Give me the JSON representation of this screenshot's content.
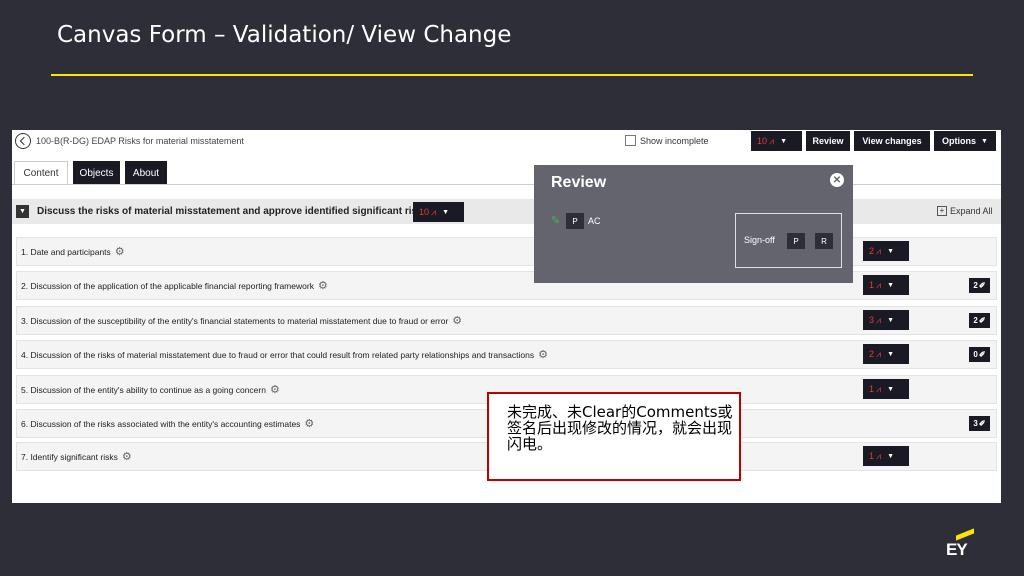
{
  "slide": {
    "title": "Canvas Form – Validation/ View Change",
    "logo": "EY"
  },
  "app": {
    "doc_title": "100-B(R-DG) EDAP Risks for material misstatement",
    "show_incomplete_label": "Show incomplete",
    "top_counter": "10",
    "review_button": "Review",
    "view_changes_button": "View changes",
    "options_button": "Options",
    "tabs": [
      {
        "label": "Content"
      },
      {
        "label": "Objects"
      },
      {
        "label": "About"
      }
    ],
    "section": {
      "title": "Discuss the risks of material misstatement and approve identified significant risks",
      "counter": "10",
      "expand_all": "Expand All"
    },
    "items": [
      {
        "label": "1. Date and participants",
        "counter": "2",
        "comments": ""
      },
      {
        "label": "2. Discussion of the application of the applicable financial reporting framework",
        "counter": "1",
        "comments": "2"
      },
      {
        "label": "3. Discussion of the susceptibility of the entity's financial statements to material misstatement due to fraud or error",
        "counter": "3",
        "comments": "2"
      },
      {
        "label": "4. Discussion of the risks of material misstatement due to fraud or error that could result from related party relationships and transactions",
        "counter": "2",
        "comments": "0"
      },
      {
        "label": "5. Discussion of the entity's ability to continue as a going concern",
        "counter": "1",
        "comments": ""
      },
      {
        "label": "6. Discussion of the risks associated with the entity's accounting estimates",
        "counter": "",
        "comments": "3"
      },
      {
        "label": "7. Identify significant risks",
        "counter": "1",
        "comments": ""
      }
    ]
  },
  "review_panel": {
    "title": "Review",
    "preparer_button": "P",
    "preparer_initials": "AC",
    "signoff_label": "Sign-off",
    "signoff_p": "P",
    "signoff_r": "R"
  },
  "annotation": {
    "text": "未完成、未Clear的Comments或签名后出现修改的情况，就会出现闪电。"
  },
  "colors": {
    "accent": "#ffe600",
    "counter_text": "#e53935",
    "dark": "#1a1a24",
    "annotation_border": "#c00000"
  }
}
